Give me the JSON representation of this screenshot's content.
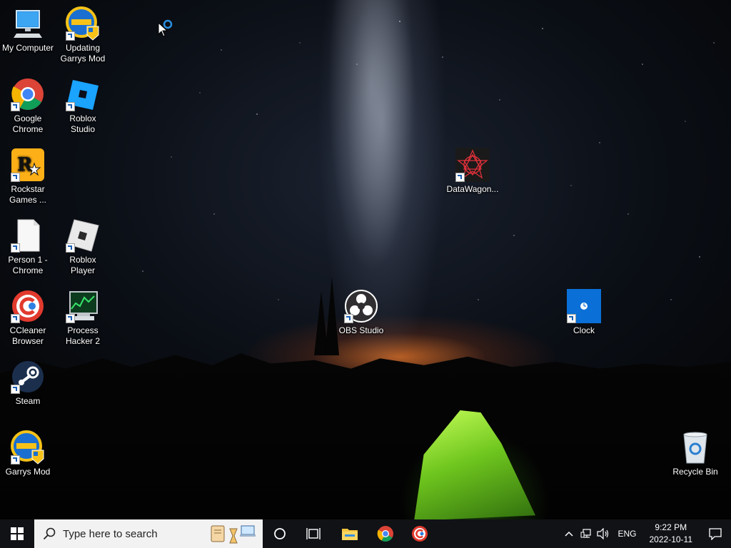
{
  "desktop": {
    "icons": [
      {
        "label": "My Computer",
        "icon": "monitor-icon"
      },
      {
        "label": "Updating Garrys Mod",
        "icon": "garrysmod-icon"
      },
      {
        "label": "Google Chrome",
        "icon": "chrome-icon"
      },
      {
        "label": "Roblox Studio",
        "icon": "roblox-studio-icon"
      },
      {
        "label": "Rockstar Games ...",
        "icon": "rockstar-icon"
      },
      {
        "label": "Person 1 - Chrome",
        "icon": "document-icon"
      },
      {
        "label": "Roblox Player",
        "icon": "roblox-player-icon"
      },
      {
        "label": "CCleaner Browser",
        "icon": "ccleaner-icon"
      },
      {
        "label": "Process Hacker 2",
        "icon": "process-hacker-icon"
      },
      {
        "label": "Steam",
        "icon": "steam-icon"
      },
      {
        "label": "Garrys Mod",
        "icon": "garrysmod-icon"
      },
      {
        "label": "DataWagon...",
        "icon": "datawagon-icon"
      },
      {
        "label": "OBS Studio",
        "icon": "obs-icon"
      },
      {
        "label": "Clock",
        "icon": "clock-icon"
      },
      {
        "label": "Recycle Bin",
        "icon": "recycle-bin-icon"
      }
    ]
  },
  "taskbar": {
    "search_placeholder": "Type here to search",
    "language": "ENG",
    "time": "9:22 PM",
    "date": "2022-10-11"
  },
  "colors": {
    "taskbar_bg": "#101216",
    "search_bg": "#f2f2f2",
    "windows_accent": "#ffffff",
    "clock_tile": "#0a6fd6"
  }
}
